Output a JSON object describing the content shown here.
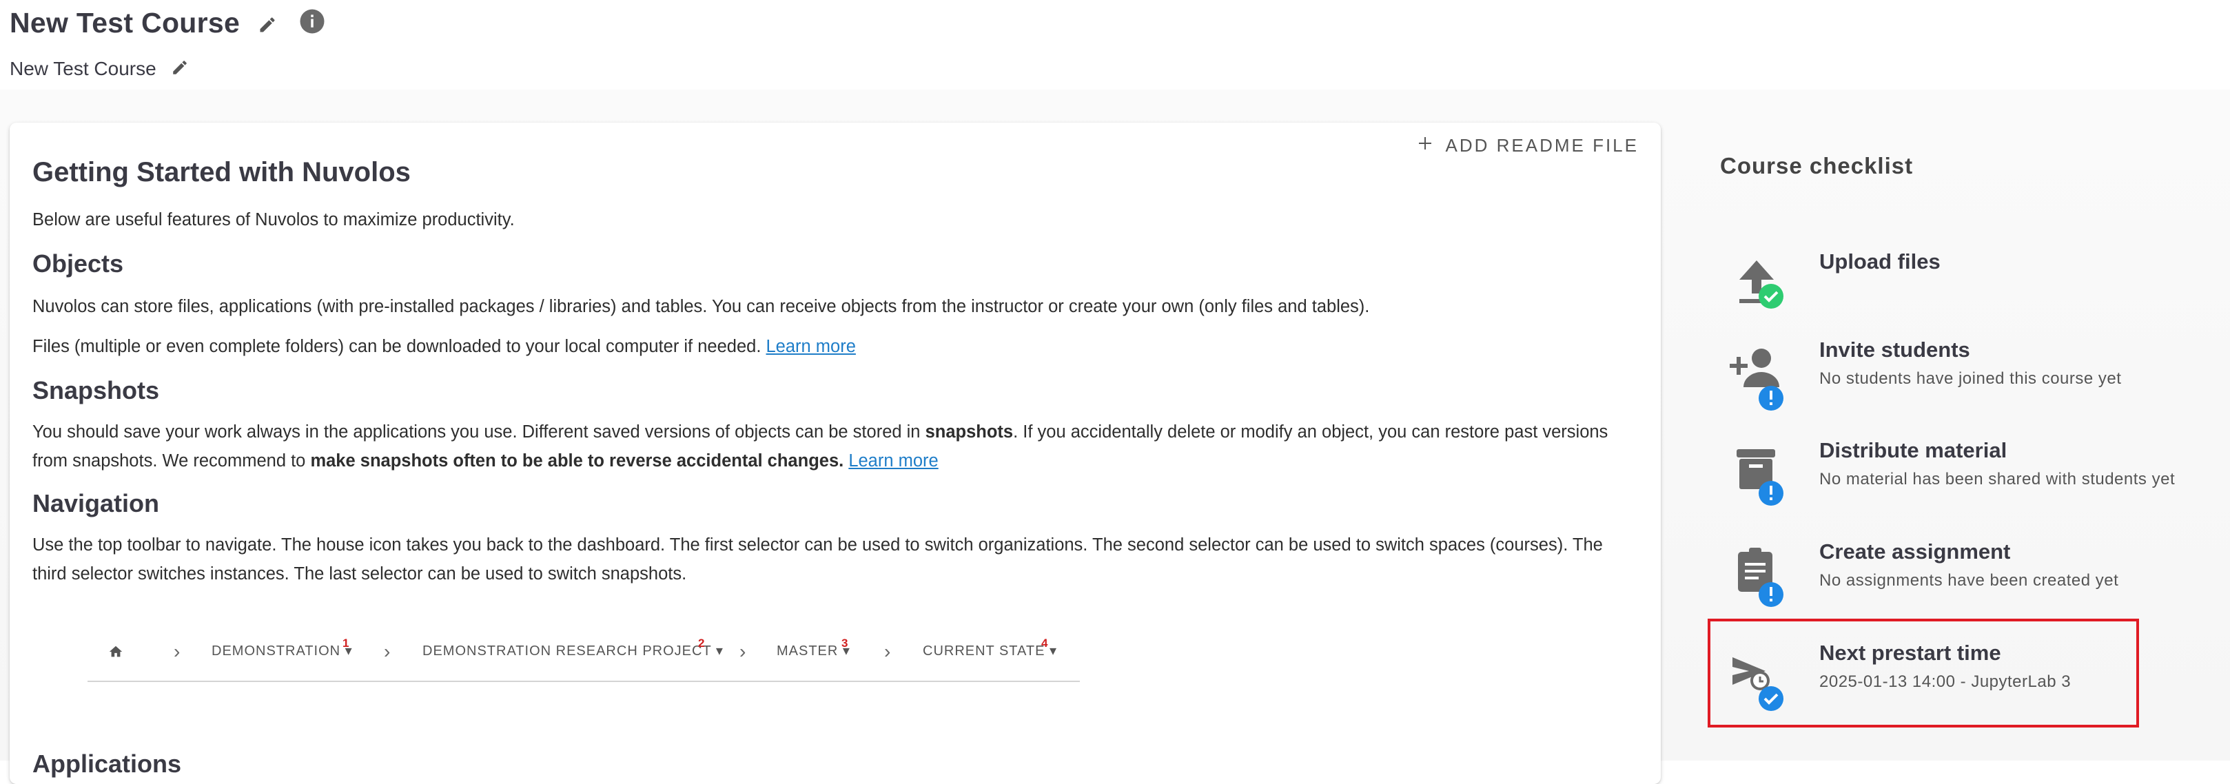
{
  "header": {
    "title": "New Test Course",
    "subtitle": "New Test Course",
    "icons": [
      "edit-icon",
      "info-icon"
    ]
  },
  "readme": {
    "add_label": "ADD README FILE"
  },
  "guide": {
    "title": "Getting Started with Nuvolos",
    "intro": "Below are useful features of Nuvolos to maximize productivity.",
    "objects_heading": "Objects",
    "objects_p1": "Nuvolos can store files, applications (with pre-installed packages / libraries) and tables. You can receive objects from the instructor or create your own (only files and tables).",
    "objects_p2": "Files (multiple or even complete folders) can be downloaded to your local computer if needed.",
    "learn_more": "Learn more",
    "snapshots_heading": "Snapshots",
    "snapshots_p1_a": "You should save your work always in the applications you use. Different saved versions of objects can be stored in ",
    "snapshots_p1_bold": "snapshots",
    "snapshots_p1_b": ". If you accidentally delete or modify an object, you can restore past versions from snapshots. We recommend to ",
    "snapshots_p1_bold2": "make snapshots often to be able to reverse accidental changes.",
    "navigation_heading": "Navigation",
    "navigation_p": "Use the top toolbar to navigate. The house icon takes you back to the dashboard. The first selector can be used to switch organizations. The second selector can be used to switch spaces (courses). The third selector switches instances. The last selector can be used to switch snapshots.",
    "applications_heading": "Applications"
  },
  "nav_example": {
    "items": [
      {
        "label": "DEMONSTRATION",
        "num": "1"
      },
      {
        "label": "DEMONSTRATION RESEARCH PROJECT",
        "num": "2"
      },
      {
        "label": "MASTER",
        "num": "3"
      },
      {
        "label": "CURRENT STATE",
        "num": "4"
      }
    ]
  },
  "checklist": {
    "title": "Course checklist",
    "items": [
      {
        "title": "Upload files",
        "desc": "",
        "icon": "upload-icon",
        "status": "done",
        "status_color": "#2ecc71"
      },
      {
        "title": "Invite students",
        "desc": "No students have joined this course yet",
        "icon": "person-add-icon",
        "status": "pending",
        "status_color": "#1e88e5"
      },
      {
        "title": "Distribute material",
        "desc": "No material has been shared with students yet",
        "icon": "archive-icon",
        "status": "pending",
        "status_color": "#1e88e5"
      },
      {
        "title": "Create assignment",
        "desc": "No assignments have been created yet",
        "icon": "clipboard-icon",
        "status": "pending",
        "status_color": "#1e88e5"
      },
      {
        "title": "Next prestart time",
        "desc": "2025-01-13 14:00 - JupyterLab 3",
        "icon": "scheduled-send-icon",
        "status": "done",
        "status_color": "#1e88e5"
      }
    ]
  },
  "colors": {
    "link": "#1e7dc8",
    "highlight": "#e01b24",
    "text_dark": "#3a3a44"
  }
}
